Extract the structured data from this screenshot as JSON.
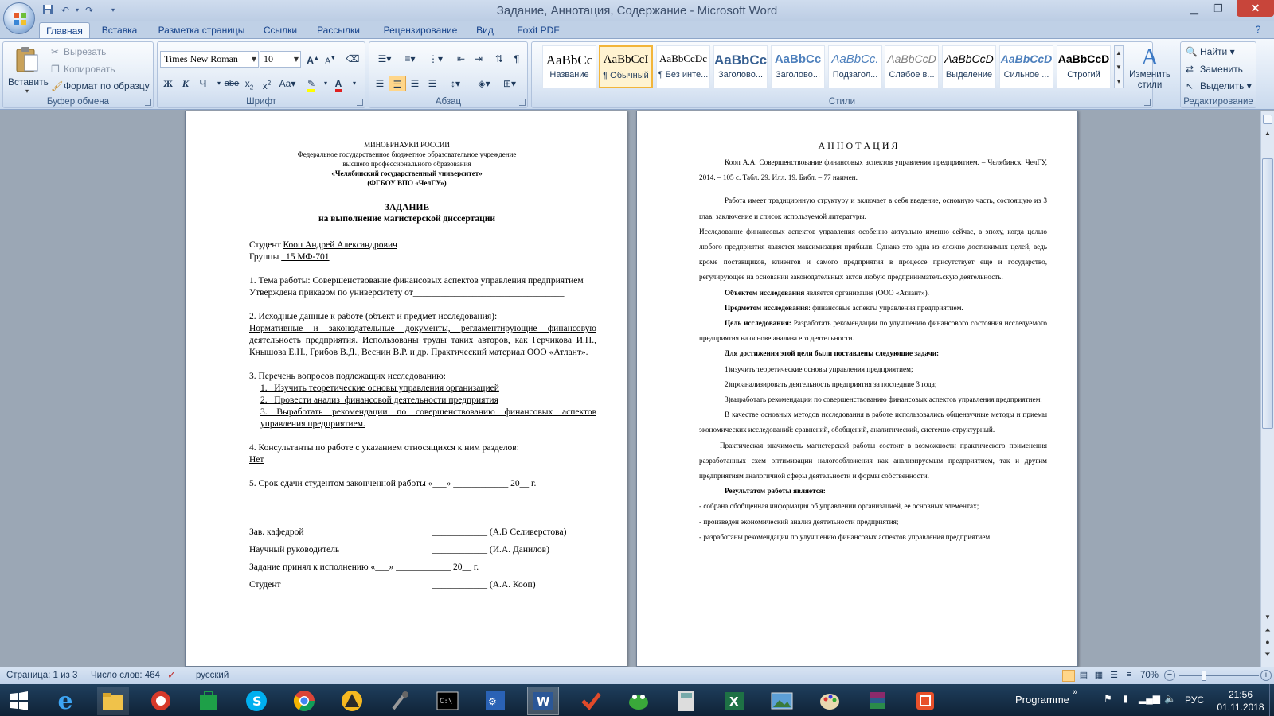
{
  "window": {
    "title": "Задание, Аннотация, Содержание - Microsoft Word"
  },
  "tabs": [
    "Главная",
    "Вставка",
    "Разметка страницы",
    "Ссылки",
    "Рассылки",
    "Рецензирование",
    "Вид",
    "Foxit PDF"
  ],
  "clipboard": {
    "paste": "Вставить",
    "cut": "Вырезать",
    "copy": "Копировать",
    "format_painter": "Формат по образцу",
    "label": "Буфер обмена"
  },
  "font": {
    "name": "Times New Roman",
    "size": "10",
    "label": "Шрифт"
  },
  "paragraph": {
    "label": "Абзац"
  },
  "styles": {
    "label": "Стили",
    "items": [
      {
        "preview": "AaBbCc",
        "name": "Название"
      },
      {
        "preview": "AaBbCcI",
        "name": "¶ Обычный"
      },
      {
        "preview": "AaBbCcDc",
        "name": "¶ Без инте..."
      },
      {
        "preview": "AaBbCc",
        "name": "Заголово..."
      },
      {
        "preview": "AaBbCc",
        "name": "Заголово..."
      },
      {
        "preview": "AaBbCc.",
        "name": "Подзагол..."
      },
      {
        "preview": "AaBbCcD",
        "name": "Слабое в..."
      },
      {
        "preview": "AaBbCcD",
        "name": "Выделение"
      },
      {
        "preview": "AaBbCcD",
        "name": "Сильное ..."
      },
      {
        "preview": "AaBbCcD",
        "name": "Строгий"
      }
    ],
    "change": "Изменить стили"
  },
  "editing": {
    "find": "Найти",
    "replace": "Заменить",
    "select": "Выделить",
    "label": "Редактирование"
  },
  "page1": {
    "h1": "МИНОБРНАУКИ РОССИИ",
    "h2": "Федеральное государственное бюджетное образовательное учреждение",
    "h3": "высшего профессионального образования",
    "h4": "«Челябинский государственный университет»",
    "h5": "(ФГБОУ ВПО «ЧелГУ»)",
    "title": "ЗАДАНИЕ",
    "subtitle": "на выполнение магистерской диссертации",
    "student_label": "Студент ",
    "student_name": "Кооп Андрей Александрович",
    "group_label": "Группы ",
    "group_value": "  15 МФ-701",
    "item1": "1. Тема работы: Совершенствование финансовых аспектов управления предприятием",
    "approved": "Утверждена приказом по университету от_________________________________",
    "item2": "2. Исходные данные к работе (объект и предмет исследования):",
    "item2_text": "Нормативные и законодательные документы, регламентирующие финансовую деятельность предприятия. Использованы труды таких авторов, как Герчикова И.Н., Кнышова Е.Н., Грибов В.Д., Веснин В.Р. и др. Практический материал ООО «Атлант».",
    "item3": "3. Перечень вопросов подлежащих исследованию:",
    "item3_1": "1.   Изучить теоретические основы управления организацией",
    "item3_2": "2.   Провести анализ  финансовой деятельности предприятия",
    "item3_3": "3.   Выработать рекомендации по совершенствованию финансовых аспектов управления предприятием.",
    "item4": "4. Консультанты по работе с указанием относящихся к ним разделов:",
    "item4_value": "Нет",
    "item5": "5. Срок сдачи студентом законченной работы «___» ____________ 20__ г.",
    "sig1_label": "Зав. кафедрой",
    "sig1_value": "____________ (А.В Селиверстова)",
    "sig2_label": "Научный руководитель",
    "sig2_value": "____________ (И.А. Данилов)",
    "sig3_label": "Задание принял к исполнению «___» ____________ 20__ г.",
    "sig4_label": "Студент",
    "sig4_value": "____________ (А.А. Кооп)"
  },
  "page2": {
    "title": "А Н Н О Т А Ц И Я",
    "p1": "Кооп А.А. Совершенствование финансовых аспектов управления предприятием. – Челябинск: ЧелГУ, 2014. – 105 с. Табл. 29. Илл. 19. Библ. – 77 наимен.",
    "p2": "Работа имеет традиционную структуру и включает в себя введение, основную часть, состоящую из 3 глав, заключение и список используемой литературы.",
    "p3": "Исследование финансовых аспектов управления особенно актуально именно сейчас, в эпоху, когда целью любого предприятия является максимизация  прибыли. Однако это одна из сложно достижимых целей, ведь кроме поставщиков, клиентов и самого предприятия в процессе присутствует  еще и государство, регулирующее на основании законодательных актов любую предпринимательскую деятельность.",
    "object_label": "Объектом исследования",
    "object_text": " является организация (ООО «Атлант»).",
    "subject_label": "Предметом исследования",
    "subject_text": ": финансовые аспекты управления предприятием.",
    "goal_label": "Цель исследования:",
    "goal_text": " Разработать рекомендации по улучшению финансового состояния исследуемого предприятия на основе анализа его деятельности.",
    "tasks_label": "Для достижения этой цели были поставлены следующие задачи:",
    "task1": "1)изучить теоретические основы управления предприятием;",
    "task2": "2)проанализировать деятельность предприятия за последние 3 года;",
    "task3": "3)выработать рекомендации по совершенствованию финансовых аспектов управления предприятием.",
    "methods": "В качестве основных методов исследования в работе использовались общенаучные методы и приемы экономических исследований: сравнений, обобщений, аналитический, системно-структурный.",
    "practical": "Практическая значимость магистерской работы состоит в возможности практического применения разработанных схем оптимизации налогообложения как анализируемым предприятием, так и другим предприятиям аналогичной сферы деятельности и формы собственности.",
    "result_label": "Результатом работы является:",
    "r1": "- собрана обобщенная  информация об управлении организацией, ее основных элементах;",
    "r2": "- произведен экономический анализ деятельности предприятия;",
    "r3": "- разработаны рекомендации по улучшению финансовых аспектов управления предприятием."
  },
  "status": {
    "page": "Страница: 1 из 3",
    "words": "Число слов: 464",
    "lang": "русский",
    "zoom": "70%"
  },
  "taskbar": {
    "programme": "Programme",
    "lang": "РУС",
    "time": "21:56",
    "date": "01.11.2018"
  }
}
